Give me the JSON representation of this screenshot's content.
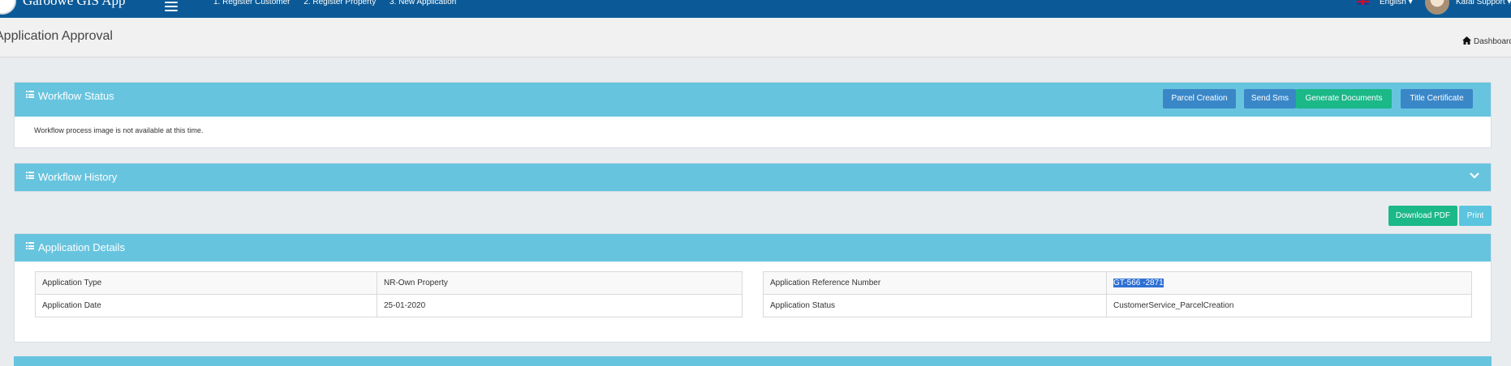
{
  "app": {
    "name": "Garoowe GIS App",
    "nav": [
      "1. Register Customer",
      "2. Register Property",
      "3. New Application"
    ],
    "language": "English",
    "user": "Kafal Support"
  },
  "header": {
    "title": "Application Approval",
    "breadcrumb": "Dashboard"
  },
  "workflow_status": {
    "title": "Workflow Status",
    "buttons": [
      "Parcel Creation",
      "Send Sms",
      "Generate Documents",
      "Title Certificate"
    ],
    "message": "Workflow process image is not available at this time."
  },
  "workflow_history": {
    "title": "Workflow History"
  },
  "actions": {
    "download_pdf": "Download PDF",
    "print": "Print"
  },
  "application_details": {
    "title": "Application Details",
    "left": [
      {
        "label": "Application Type",
        "value": "NR-Own Property"
      },
      {
        "label": "Application Date",
        "value": "25-01-2020"
      }
    ],
    "right": [
      {
        "label": "Application Reference Number",
        "value": "GT-566 -2871"
      },
      {
        "label": "Application Status",
        "value": "CustomerService_ParcelCreation"
      }
    ]
  },
  "colors": {
    "navbar": "#0b5a97",
    "panel_header": "#67c4df",
    "primary_button": "#3a87c8",
    "success_button": "#1bb888",
    "info_button": "#5bc4de"
  }
}
